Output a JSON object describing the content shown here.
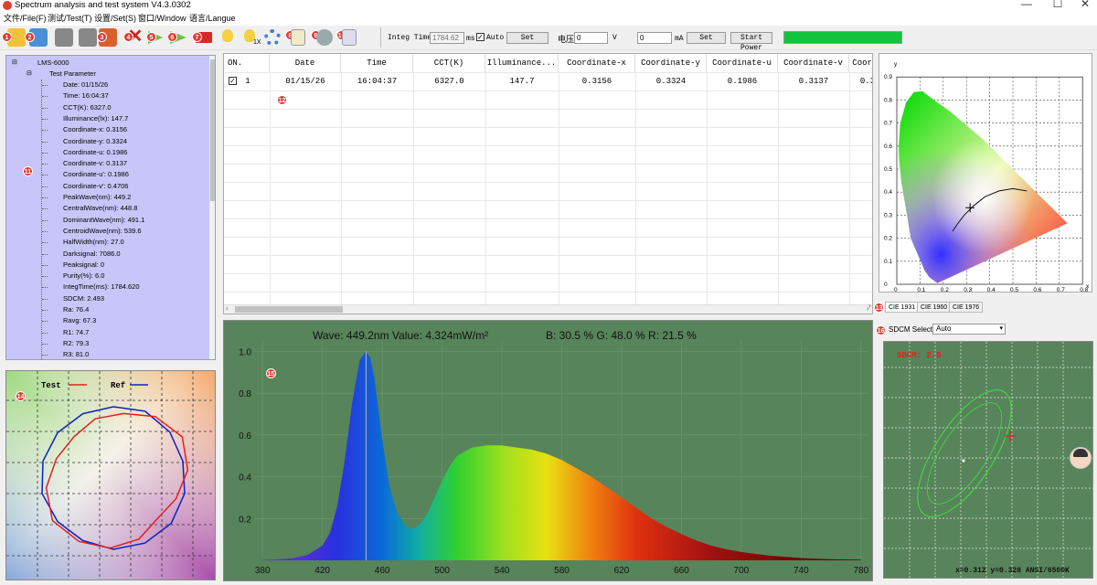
{
  "window": {
    "title": "Spectrum analysis and test system V4.3.0302",
    "min_label": "—",
    "max_label": "☐",
    "close_label": "✕"
  },
  "menu": [
    "文件/File(F)",
    "测试/Test(T)",
    "设置/Set(S)",
    "窗口/Window",
    "语言/Langue"
  ],
  "toolbar": {
    "badges": [
      "1",
      "2",
      "3",
      "4",
      "5",
      "6",
      "7",
      "8",
      "9",
      "10"
    ],
    "sub_label": "1X",
    "integ_label": "Integ Time",
    "integ_value": "1784.62",
    "integ_unit": "ms",
    "auto_label": "Auto",
    "set_label": "Set",
    "voltage_label": "电压",
    "voltage_value": "0",
    "voltage_unit": "V",
    "current_value": "0",
    "current_unit": "mA",
    "set2_label": "Set",
    "start_power_label": "Start Power",
    "progress": 1.0,
    "progress_color": "#12c33c"
  },
  "tree": {
    "root": "LMS-6000",
    "group": "Test Parameter",
    "items": [
      "Date: 01/15/26",
      "Time: 16:04:37",
      "CCT(K): 6327.0",
      "Illuminance(lx): 147.7",
      "Coordinate-x: 0.3156",
      "Coordinate-y: 0.3324",
      "Coordinate-u: 0.1986",
      "Coordinate-v: 0.3137",
      "Coordinate-u': 0.1986",
      "Coordinate-v': 0.4706",
      "PeakWave(nm): 449.2",
      "CentralWave(nm): 448.8",
      "DominantWave(nm): 491.1",
      "CentroidWave(nm): 539.6",
      "HalfWidth(nm): 27.0",
      "Darksignal: 7086.0",
      "Peaksignal: 0",
      "Purity(%): 6.0",
      "IntegTime(ms): 1784.620",
      "SDCM: 2.493",
      "Ra: 76.4",
      "Ravg: 67.3",
      "R1: 74.7",
      "R2: 79.3",
      "R3: 81.0"
    ],
    "badge": "11"
  },
  "table": {
    "badge": "12",
    "columns": [
      "ON.",
      "Date",
      "Time",
      "CCT(K)",
      "Illuminance...",
      "Coordinate-x",
      "Coordinate-y",
      "Coordinate-u",
      "Coordinate-v",
      "Coordi"
    ],
    "rows": [
      {
        "on": "1",
        "checked": true,
        "cells": [
          "01/15/26",
          "16:04:37",
          "6327.0",
          "147.7",
          "0.3156",
          "0.3324",
          "0.1986",
          "0.3137",
          "0.3"
        ]
      }
    ]
  },
  "cie": {
    "badge": "13",
    "tabs": [
      "CIE 1931",
      "CIE 1960",
      "CIE 1976"
    ],
    "y_label": "y",
    "x_label": "x",
    "x_ticks": [
      "0",
      "0.1",
      "0.2",
      "0.3",
      "0.4",
      "0.5",
      "0.6",
      "0.7",
      "0.8"
    ],
    "y_ticks": [
      "0.9",
      "0.8",
      "0.7",
      "0.6",
      "0.5",
      "0.4",
      "0.3",
      "0.2",
      "0.1",
      "0"
    ],
    "point": {
      "x": 0.3156,
      "y": 0.3324
    }
  },
  "cri": {
    "badge": "14",
    "test_label": "Test",
    "ref_label": "Ref",
    "test_color": "#e02020",
    "ref_color": "#1020c0"
  },
  "chart_data": {
    "type": "area",
    "title": "",
    "header_text": "Wave: 449.2nm Value: 4.324mW/m²",
    "rgb_text": "B: 30.5 %  G: 48.0 %  R: 21.5 %",
    "xlabel": "",
    "ylabel": "",
    "x_ticks": [
      380,
      420,
      460,
      500,
      540,
      580,
      620,
      660,
      700,
      740,
      780
    ],
    "y_ticks": [
      0.2,
      0.4,
      0.6,
      0.8,
      1.0
    ],
    "xlim": [
      375,
      785
    ],
    "ylim": [
      0,
      1.05
    ],
    "marker_x": 449.2,
    "badge": "15",
    "x": [
      380,
      390,
      400,
      410,
      420,
      425,
      430,
      435,
      440,
      445,
      449,
      452,
      455,
      460,
      465,
      470,
      475,
      480,
      485,
      490,
      495,
      500,
      505,
      510,
      520,
      530,
      540,
      550,
      560,
      570,
      580,
      590,
      600,
      610,
      620,
      630,
      640,
      650,
      660,
      670,
      680,
      690,
      700,
      710,
      720,
      730,
      740,
      750,
      760,
      770,
      780
    ],
    "y": [
      0.002,
      0.005,
      0.01,
      0.025,
      0.07,
      0.13,
      0.26,
      0.48,
      0.76,
      0.96,
      1.0,
      0.97,
      0.86,
      0.58,
      0.35,
      0.23,
      0.17,
      0.15,
      0.17,
      0.22,
      0.3,
      0.38,
      0.45,
      0.5,
      0.54,
      0.55,
      0.55,
      0.54,
      0.53,
      0.51,
      0.48,
      0.44,
      0.4,
      0.35,
      0.3,
      0.25,
      0.2,
      0.16,
      0.125,
      0.095,
      0.07,
      0.053,
      0.04,
      0.03,
      0.022,
      0.016,
      0.011,
      0.008,
      0.005,
      0.004,
      0.003
    ]
  },
  "sdcm": {
    "badge": "16",
    "select_label": "SDCM Select",
    "select_value": "Auto",
    "value_text": "SDCM: 2.5",
    "coord_text": "x=0.312 y=0.328 ANSI/6500K"
  }
}
